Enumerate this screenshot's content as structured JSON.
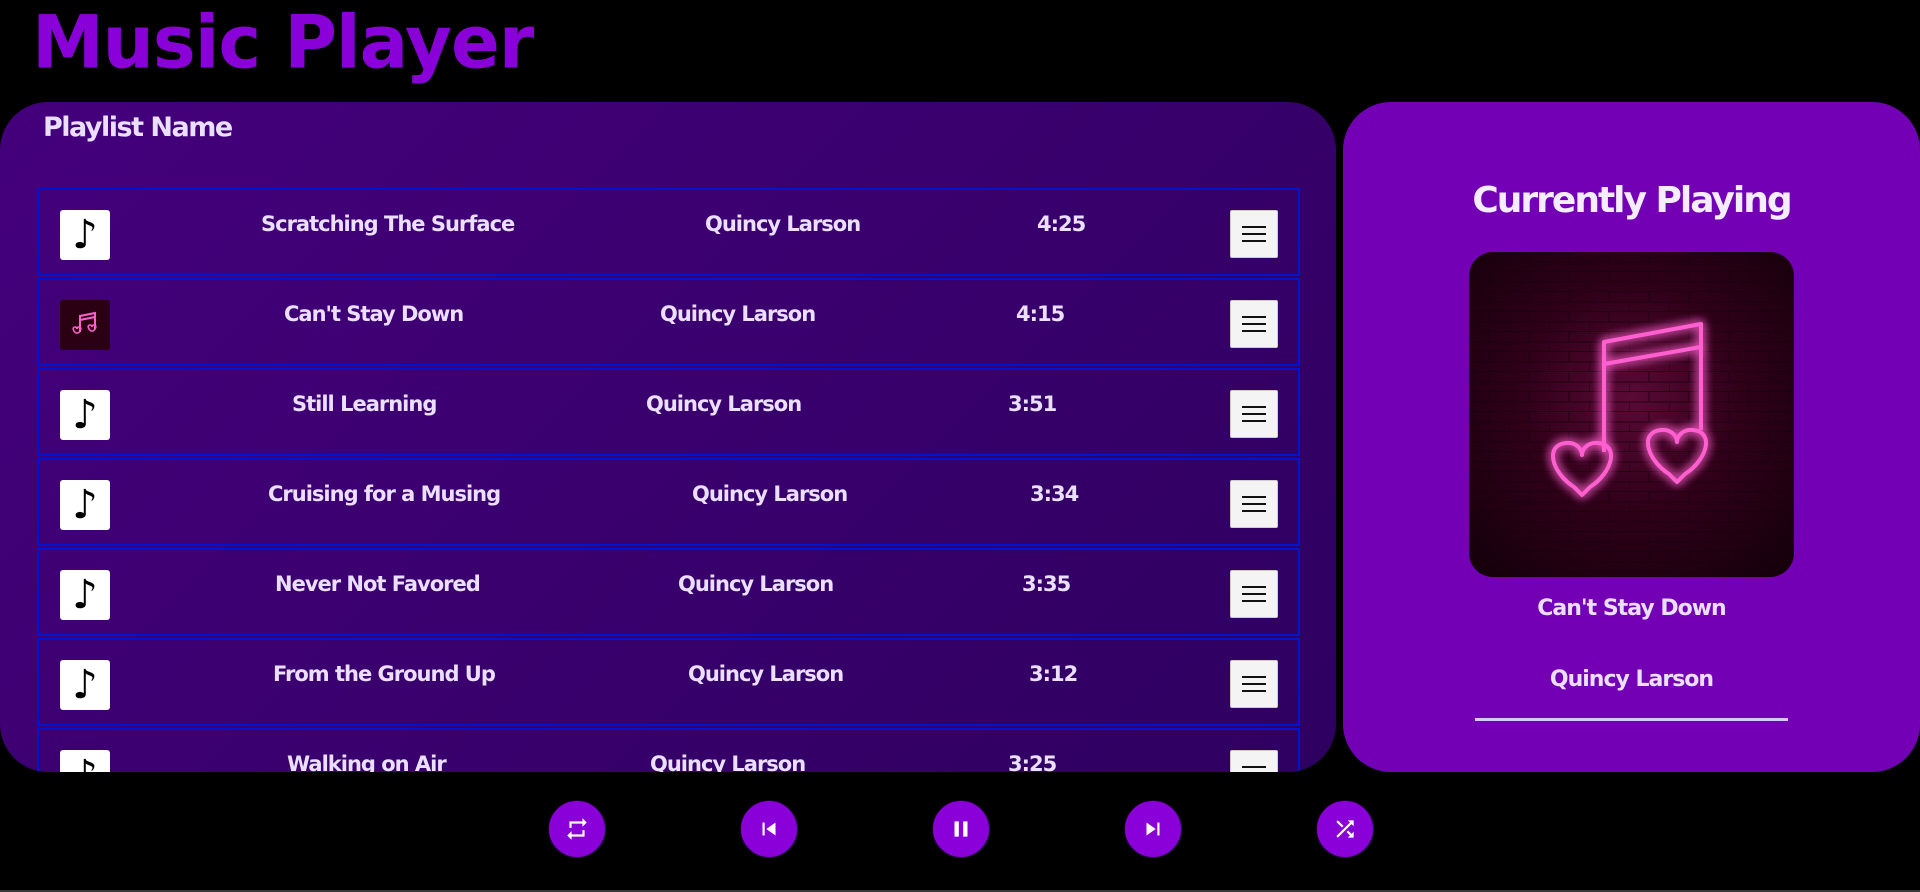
{
  "app": {
    "title": "Music Player"
  },
  "playlist": {
    "name": "Playlist Name",
    "tracks": [
      {
        "title": "Scratching The Surface",
        "artist": "Quincy Larson",
        "duration": "4:25",
        "thumb_icon": "music-note-icon"
      },
      {
        "title": "Can't Stay Down",
        "artist": "Quincy Larson",
        "duration": "4:15",
        "thumb_icon": "neon-heart-note-icon"
      },
      {
        "title": "Still Learning",
        "artist": "Quincy Larson",
        "duration": "3:51",
        "thumb_icon": "music-note-icon"
      },
      {
        "title": "Cruising for a Musing",
        "artist": "Quincy Larson",
        "duration": "3:34",
        "thumb_icon": "music-note-icon"
      },
      {
        "title": "Never Not Favored",
        "artist": "Quincy Larson",
        "duration": "3:35",
        "thumb_icon": "music-note-icon"
      },
      {
        "title": "From the Ground Up",
        "artist": "Quincy Larson",
        "duration": "3:12",
        "thumb_icon": "music-note-icon"
      },
      {
        "title": "Walking on Air",
        "artist": "Quincy Larson",
        "duration": "3:25",
        "thumb_icon": "music-note-icon"
      }
    ]
  },
  "now_playing": {
    "heading": "Currently Playing",
    "title": "Can't Stay Down",
    "artist": "Quincy Larson",
    "progress": 0,
    "cover_icon": "neon-heart-note-icon"
  },
  "controls": [
    {
      "name": "repeat",
      "icon": "repeat-icon"
    },
    {
      "name": "previous",
      "icon": "previous-icon"
    },
    {
      "name": "pause",
      "icon": "pause-icon"
    },
    {
      "name": "next",
      "icon": "next-icon"
    },
    {
      "name": "shuffle",
      "icon": "shuffle-icon"
    }
  ],
  "colors": {
    "accent": "#8a00d8",
    "playlist_bg": "#3b006f",
    "now_playing_bg": "#7400b6",
    "row_border": "#0014d0",
    "neon_pink": "#ff4fc6"
  }
}
